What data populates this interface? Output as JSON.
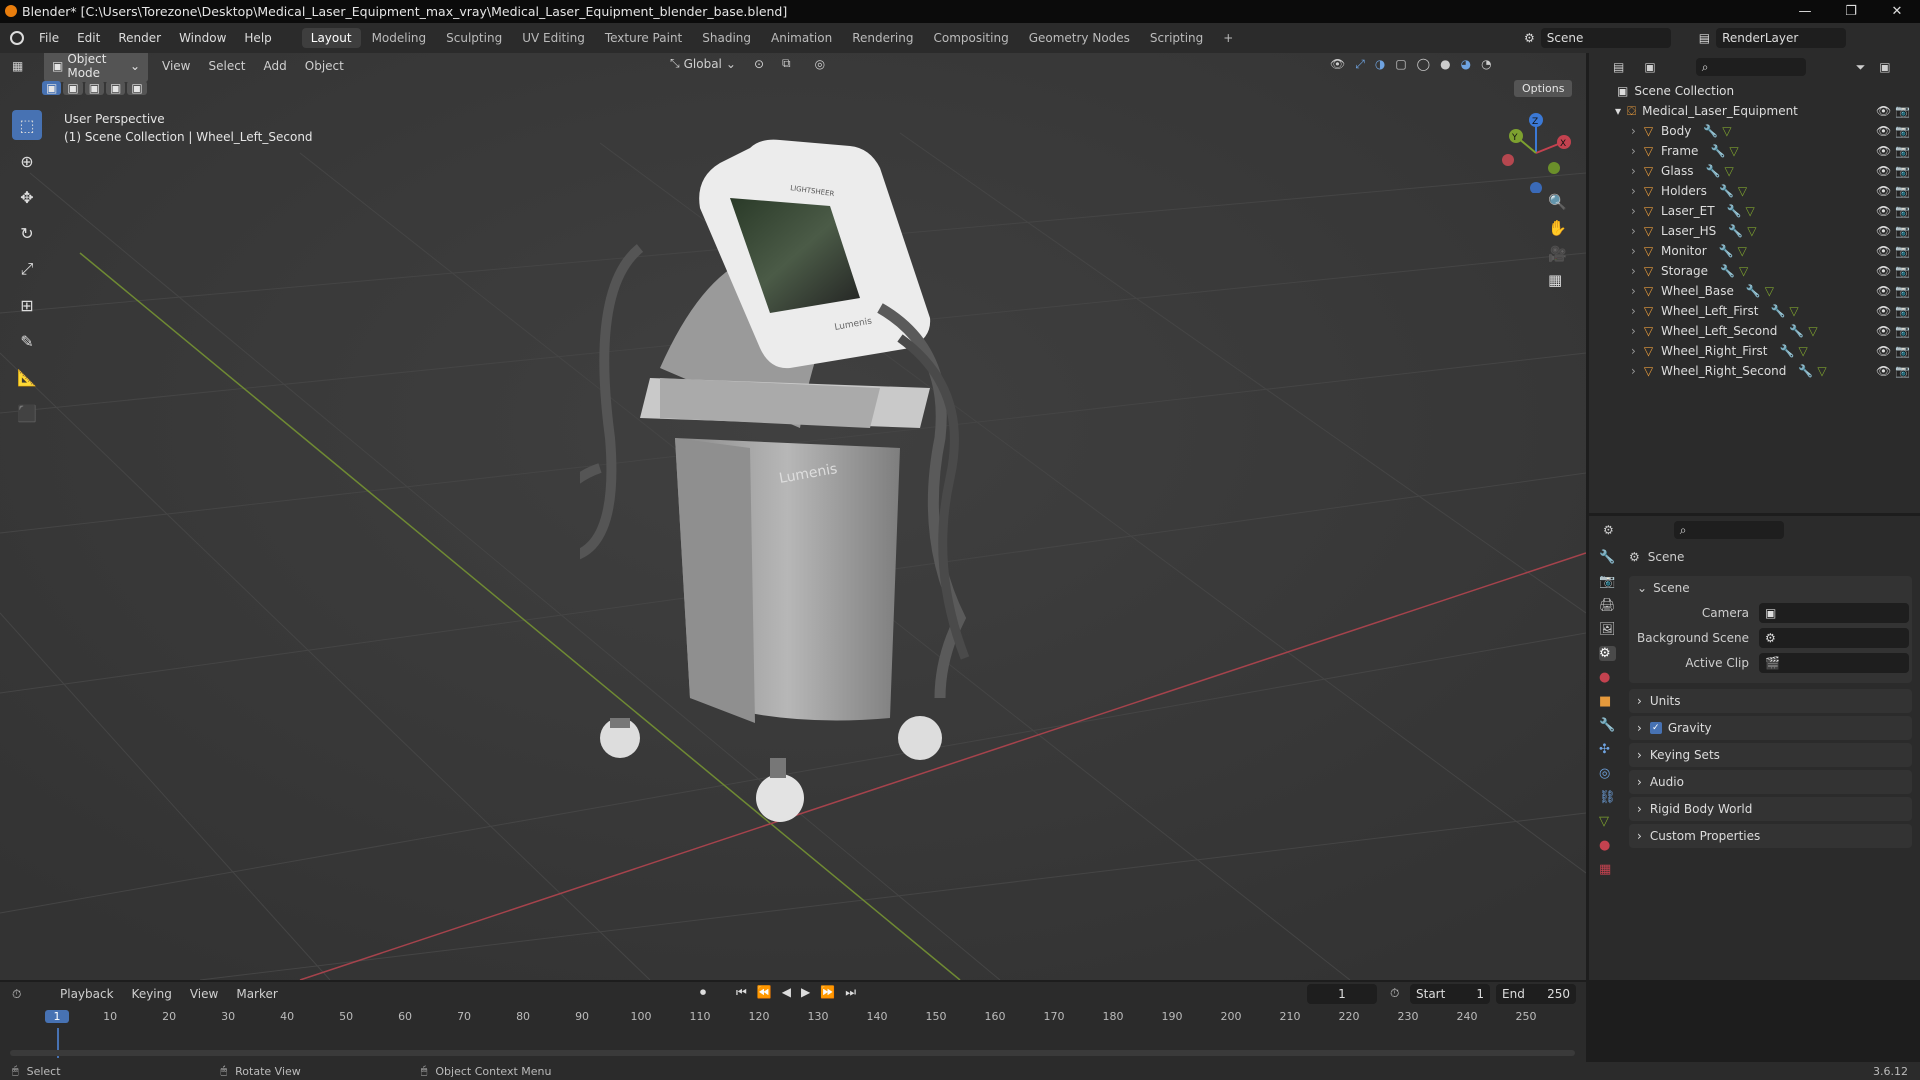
{
  "title": "Blender* [C:\\Users\\Torezone\\Desktop\\Medical_Laser_Equipment_max_vray\\Medical_Laser_Equipment_blender_base.blend]",
  "menu": [
    "File",
    "Edit",
    "Render",
    "Window",
    "Help"
  ],
  "workspaces": [
    "Layout",
    "Modeling",
    "Sculpting",
    "UV Editing",
    "Texture Paint",
    "Shading",
    "Animation",
    "Rendering",
    "Compositing",
    "Geometry Nodes",
    "Scripting"
  ],
  "scene_name": "Scene",
  "render_layer": "RenderLayer",
  "viewport": {
    "mode": "Object Mode",
    "menus": [
      "View",
      "Select",
      "Add",
      "Object"
    ],
    "orientation": "Global",
    "options": "Options",
    "info_line1": "User Perspective",
    "info_line2": "(1) Scene Collection | Wheel_Left_Second",
    "gizmo_axes": [
      "Z",
      "Y",
      "X"
    ],
    "model_brand": "Lumenis",
    "model_screen_brand": "LIGHTSHEER"
  },
  "outliner": {
    "root": "Scene Collection",
    "collection": "Medical_Laser_Equipment",
    "objects": [
      "Body",
      "Frame",
      "Glass",
      "Holders",
      "Laser_ET",
      "Laser_HS",
      "Monitor",
      "Storage",
      "Wheel_Base",
      "Wheel_Left_First",
      "Wheel_Left_Second",
      "Wheel_Right_First",
      "Wheel_Right_Second"
    ]
  },
  "properties": {
    "context": "Scene",
    "panel": "Scene",
    "fields": [
      {
        "label": "Camera",
        "value": ""
      },
      {
        "label": "Background Scene",
        "value": ""
      },
      {
        "label": "Active Clip",
        "value": ""
      }
    ],
    "subpanels": [
      "Units",
      "Gravity",
      "Keying Sets",
      "Audio",
      "Rigid Body World",
      "Custom Properties"
    ],
    "gravity_checked": true
  },
  "timeline": {
    "menus": [
      "Playback",
      "Keying",
      "View",
      "Marker"
    ],
    "current_frame": "1",
    "start_label": "Start",
    "start": "1",
    "end_label": "End",
    "end": "250",
    "ticks": [
      "1",
      "10",
      "20",
      "30",
      "40",
      "50",
      "60",
      "70",
      "80",
      "90",
      "100",
      "110",
      "120",
      "130",
      "140",
      "150",
      "160",
      "170",
      "180",
      "190",
      "200",
      "210",
      "220",
      "230",
      "240",
      "250"
    ]
  },
  "status": {
    "select": "Select",
    "rotate": "Rotate View",
    "context": "Object Context Menu",
    "version": "3.6.12"
  },
  "colors": {
    "accent": "#4772b3",
    "x_axis": "#c3424f",
    "y_axis": "#7da12f",
    "z_axis": "#3b79d6"
  }
}
